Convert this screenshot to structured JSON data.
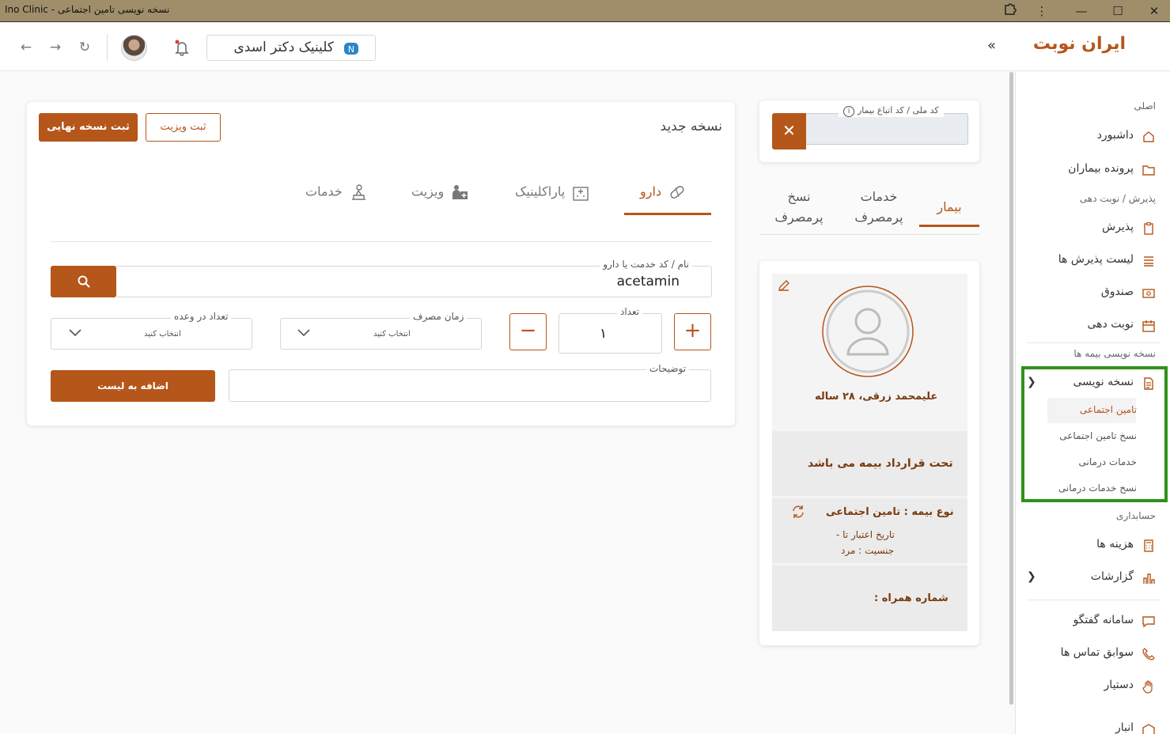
{
  "window": {
    "title": "Ino Clinic - نسخه نویسی تامین اجتماعی",
    "controls": [
      "extension-icon",
      "more-icon",
      "minimize-icon",
      "maximize-icon",
      "close-icon"
    ]
  },
  "header": {
    "logo": "ایران نوبت",
    "collapse_glyph": "«",
    "clinic_name": "کلینیک دکتر اسدی",
    "nav": {
      "back": "←",
      "forward": "→",
      "refresh": "↻"
    }
  },
  "sidebar": {
    "sections": {
      "main": "اصلی",
      "reception": "پذیرش / نوبت دهی",
      "insurance": "نسخه نویسی بیمه ها",
      "accounting": "حسابداری"
    },
    "items": {
      "dashboard": "داشبورد",
      "patient_files": "پرونده بیماران",
      "reception": "پذیرش",
      "reception_list": "لیست پذیرش ها",
      "cashbox": "صندوق",
      "appointments": "نوبت دهی",
      "prescription": "نسخه نویسی",
      "expenses": "هزینه ها",
      "reports": "گزارشات",
      "chat": "سامانه گفتگو",
      "call_history": "سوابق تماس ها",
      "assistant": "دستیار",
      "warehouse": "انبار"
    },
    "subitems": {
      "social_security": "تامین اجتماعی",
      "social_security_rx": "نسخ تامین اجتماعی",
      "medical_services": "خدمات درمانی",
      "medical_services_rx": "نسخ خدمات درمانی"
    }
  },
  "patient_panel": {
    "id_label": "کد ملی / کد اتباع بیمار",
    "id_value": "",
    "clear_glyph": "✕",
    "tabs": {
      "patient": "بیمار",
      "frequent_services": "خدمات پرمصرف",
      "frequent_rx": "نسخ پرمصرف"
    },
    "active_tab": "بیمار",
    "patient_name": "علیمحمد زرقی، ۲۸ ساله",
    "contract_status": "تحت قرارداد بیمه می باشد",
    "insurance_type": "نوع بیمه : تامین اجتماعی",
    "validity": "تاریخ اعتبار تا -",
    "gender": "جنسیت : مرد",
    "phone": "شماره همراه :"
  },
  "prescription": {
    "title": "نسخه جدید",
    "final_button": "ثبت نسخه نهایی",
    "visit_button": "ثبت ویزیت",
    "tabs": {
      "drug": "دارو",
      "paraclinic": "پاراکلینیک",
      "visit": "ویزیت",
      "services": "خدمات"
    },
    "active_tab": "دارو",
    "search": {
      "label": "نام / کد خدمت یا دارو",
      "value": "acetamin"
    },
    "quantity": {
      "label": "تعداد",
      "value": "۱"
    },
    "usage_time": {
      "label": "زمان مصرف",
      "placeholder": "انتخاب کنید"
    },
    "per_dose": {
      "label": "تعداد در وعده",
      "placeholder": "انتخاب کنید"
    },
    "notes": {
      "label": "توضیحات",
      "value": ""
    },
    "add_button": "اضافه به لیست"
  },
  "colors": {
    "accent": "#b5561a",
    "titlebar": "#a08e6a",
    "highlight_border": "#2e9319"
  }
}
